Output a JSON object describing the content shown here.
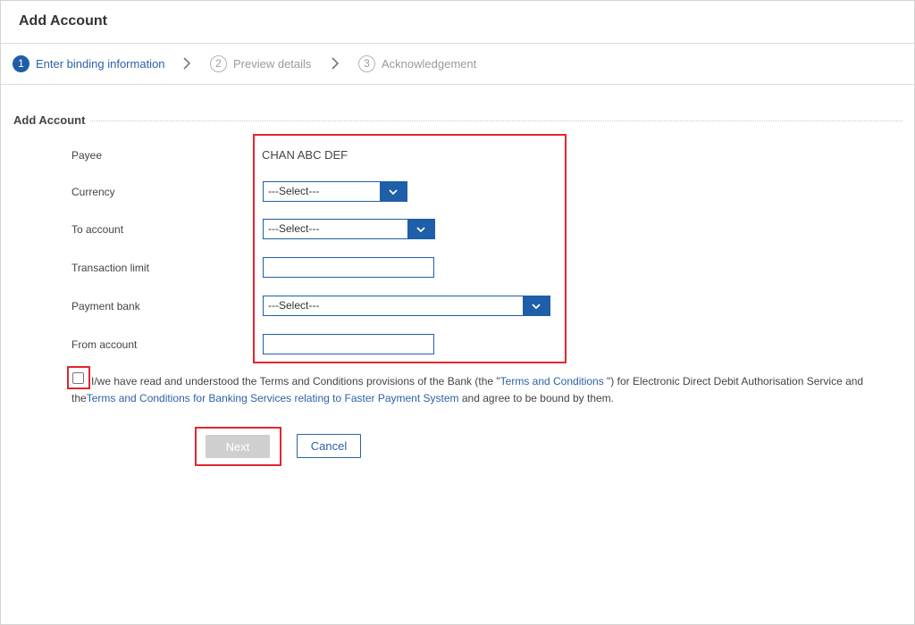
{
  "header": {
    "title": "Add Account"
  },
  "steps": [
    {
      "number": "1",
      "label": "Enter binding information",
      "state": "active"
    },
    {
      "number": "2",
      "label": "Preview details",
      "state": "inactive"
    },
    {
      "number": "3",
      "label": "Acknowledgement",
      "state": "inactive"
    }
  ],
  "section": {
    "title": "Add Account"
  },
  "form": {
    "payee": {
      "label": "Payee",
      "value": "CHAN ABC DEF"
    },
    "currency": {
      "label": "Currency",
      "selected": "---Select---"
    },
    "to_account": {
      "label": "To account",
      "selected": "---Select---"
    },
    "transaction_limit": {
      "label": "Transaction limit",
      "value": ""
    },
    "payment_bank": {
      "label": "Payment bank",
      "selected": "---Select---"
    },
    "from_account": {
      "label": "From account",
      "value": ""
    }
  },
  "terms": {
    "checked": false,
    "text_1": "I/we have read and understood the Terms and Conditions provisions of the Bank (the \"",
    "link_1": "Terms and Conditions ",
    "text_2": "\") for Electronic Direct Debit Authorisation Service and",
    "text_3": "the",
    "link_2": "Terms and Conditions for Banking Services relating to Faster Payment System",
    "text_4": " and agree to be bound by them."
  },
  "buttons": {
    "next": "Next",
    "cancel": "Cancel"
  },
  "colors": {
    "accent": "#1f5ea8",
    "link": "#2b62a6",
    "highlight": "#e3262d",
    "disabled": "#cfcfcf"
  }
}
